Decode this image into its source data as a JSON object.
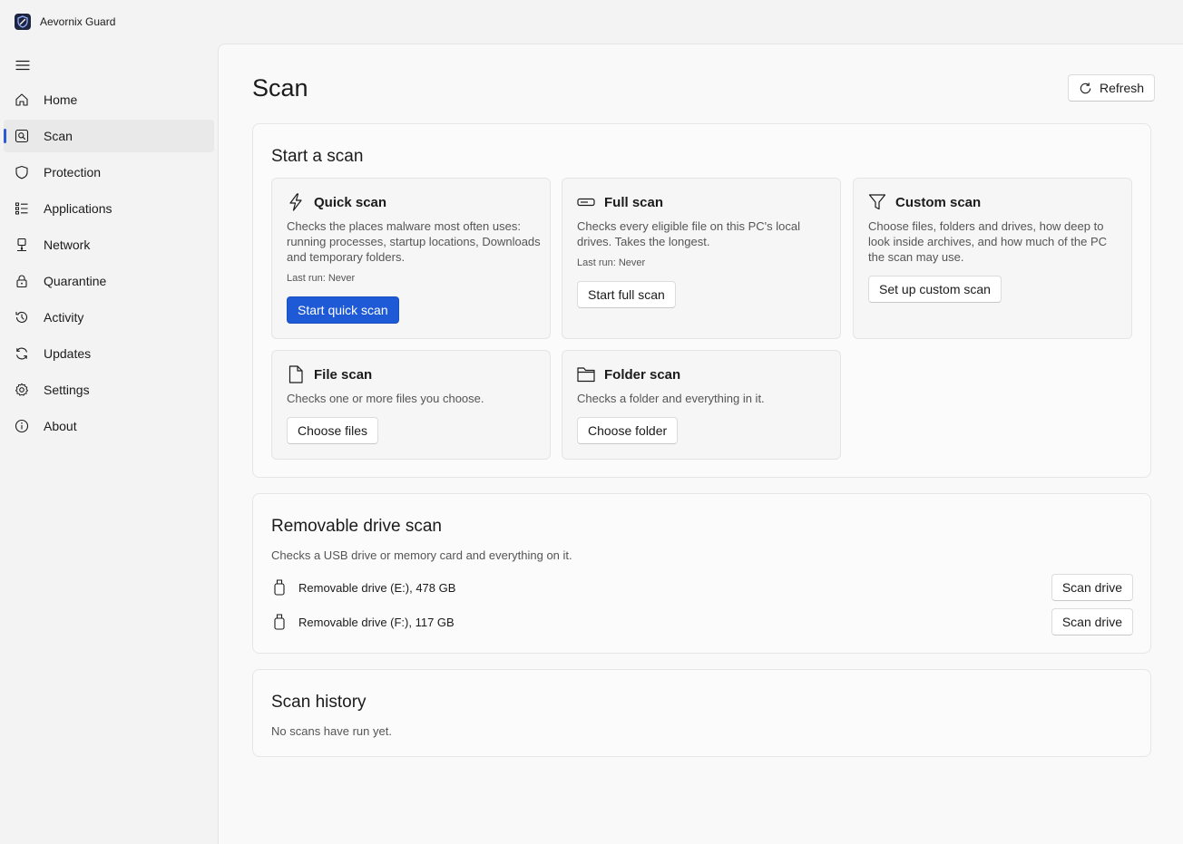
{
  "app": {
    "title": "Aevornix Guard",
    "icon": "shield-logo-icon"
  },
  "sidebar": {
    "menu_icon": "hamburger-icon",
    "items": [
      {
        "label": "Home",
        "icon": "home-icon",
        "active": false
      },
      {
        "label": "Scan",
        "icon": "scan-icon",
        "active": true
      },
      {
        "label": "Protection",
        "icon": "shield-icon",
        "active": false
      },
      {
        "label": "Applications",
        "icon": "apps-list-icon",
        "active": false
      },
      {
        "label": "Network",
        "icon": "network-icon",
        "active": false
      },
      {
        "label": "Quarantine",
        "icon": "lock-icon",
        "active": false
      },
      {
        "label": "Activity",
        "icon": "history-icon",
        "active": false
      },
      {
        "label": "Updates",
        "icon": "sync-icon",
        "active": false
      },
      {
        "label": "Settings",
        "icon": "gear-icon",
        "active": false
      },
      {
        "label": "About",
        "icon": "info-icon",
        "active": false
      }
    ]
  },
  "page": {
    "title": "Scan",
    "refresh_label": "Refresh"
  },
  "start_scan": {
    "title": "Start a scan",
    "quick": {
      "title": "Quick scan",
      "icon": "lightning-icon",
      "description": "Checks the places malware most often uses: running processes, startup locations, Downloads and temporary folders.",
      "last_run": "Last run: Never",
      "button": "Start quick scan"
    },
    "full": {
      "title": "Full scan",
      "icon": "drive-icon",
      "description": "Checks every eligible file on this PC's local drives. Takes the longest.",
      "last_run": "Last run: Never",
      "button": "Start full scan"
    },
    "custom": {
      "title": "Custom scan",
      "icon": "filter-icon",
      "description": "Choose files, folders and drives, how deep to look inside archives, and how much of the PC the scan may use.",
      "button": "Set up custom scan"
    },
    "file": {
      "title": "File scan",
      "icon": "document-icon",
      "description": "Checks one or more files you choose.",
      "button": "Choose files"
    },
    "folder": {
      "title": "Folder scan",
      "icon": "folder-icon",
      "description": "Checks a folder and everything in it.",
      "button": "Choose folder"
    }
  },
  "removable": {
    "title": "Removable drive scan",
    "description": "Checks a USB drive or memory card and everything on it.",
    "drives": [
      {
        "label": "Removable drive (E:), 478 GB",
        "button": "Scan drive",
        "icon": "usb-drive-icon"
      },
      {
        "label": "Removable drive (F:), 117 GB",
        "button": "Scan drive",
        "icon": "usb-drive-icon"
      }
    ]
  },
  "history": {
    "title": "Scan history",
    "empty_text": "No scans have run yet."
  },
  "colors": {
    "accent": "#1f5ad6",
    "sidebar_bg": "#f3f3f3",
    "content_bg": "#f9f9f9"
  }
}
